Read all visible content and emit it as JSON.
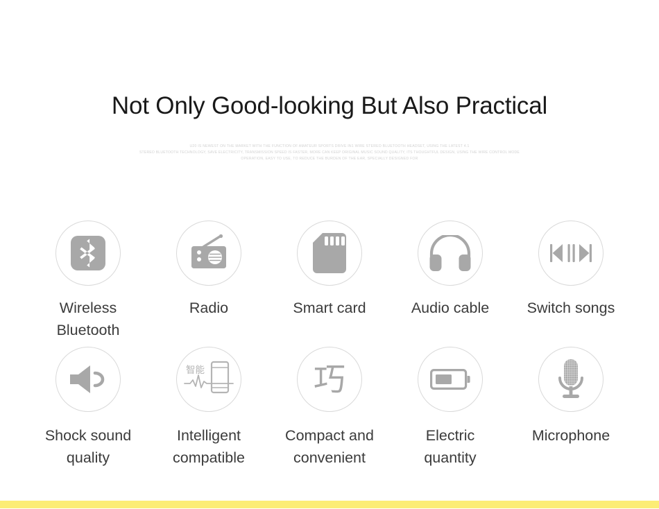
{
  "header": {
    "title": "Not Only Good-looking But Also Practical",
    "paragraph_lines": [
      "U20 IS NEWEST ON THE MARKET WITH THE FUNCTION OF AMATEUR SPORTS DRIVE IN1 WIRE STEREO BLUETOOTH HEADSET, USING THE LATEST 4.1",
      "STEREO BLUETOOTH TECHNOLOGY, SAVE ELECTRICITY, TRANSMISSION SPEED IS FASTER, MORE CAN KEEP ORIGINAL MUSIC SOUND QUALITY, ITS THOUGHTFUL DESIGN, USING THE WIRE CONTROL MODE",
      "OPERATION, EASY TO USE, TO REDUCE THE BURDEN OF THE EAR, SPECIALLY DESIGNED FOR"
    ]
  },
  "features": {
    "row1": [
      {
        "icon": "bluetooth-icon",
        "label": "Wireless Bluetooth"
      },
      {
        "icon": "radio-icon",
        "label": "Radio"
      },
      {
        "icon": "sd-card-icon",
        "label": "Smart card"
      },
      {
        "icon": "headphones-icon",
        "label": "Audio cable"
      },
      {
        "icon": "track-switch-icon",
        "label": "Switch songs"
      }
    ],
    "row2": [
      {
        "icon": "speaker-icon",
        "label": "Shock sound\nquality"
      },
      {
        "icon": "smart-phone-waveform-icon",
        "label": "Intelligent\ncompatible",
        "glyph": "智能"
      },
      {
        "icon": "chinese-character-qiao-icon",
        "label": "Compact and\nconvenient",
        "glyph": "巧"
      },
      {
        "icon": "battery-icon",
        "label": "Electric\nquantity"
      },
      {
        "icon": "microphone-icon",
        "label": "Microphone"
      }
    ]
  },
  "colors": {
    "title_text": "#191919",
    "caption_text": "#3b3b3b",
    "paragraph_text": "#d2d2d2",
    "icon_gray": "#a8a8a8",
    "circle_border": "#d9d9d9",
    "accent_band": "#fced75",
    "background": "#ffffff"
  }
}
